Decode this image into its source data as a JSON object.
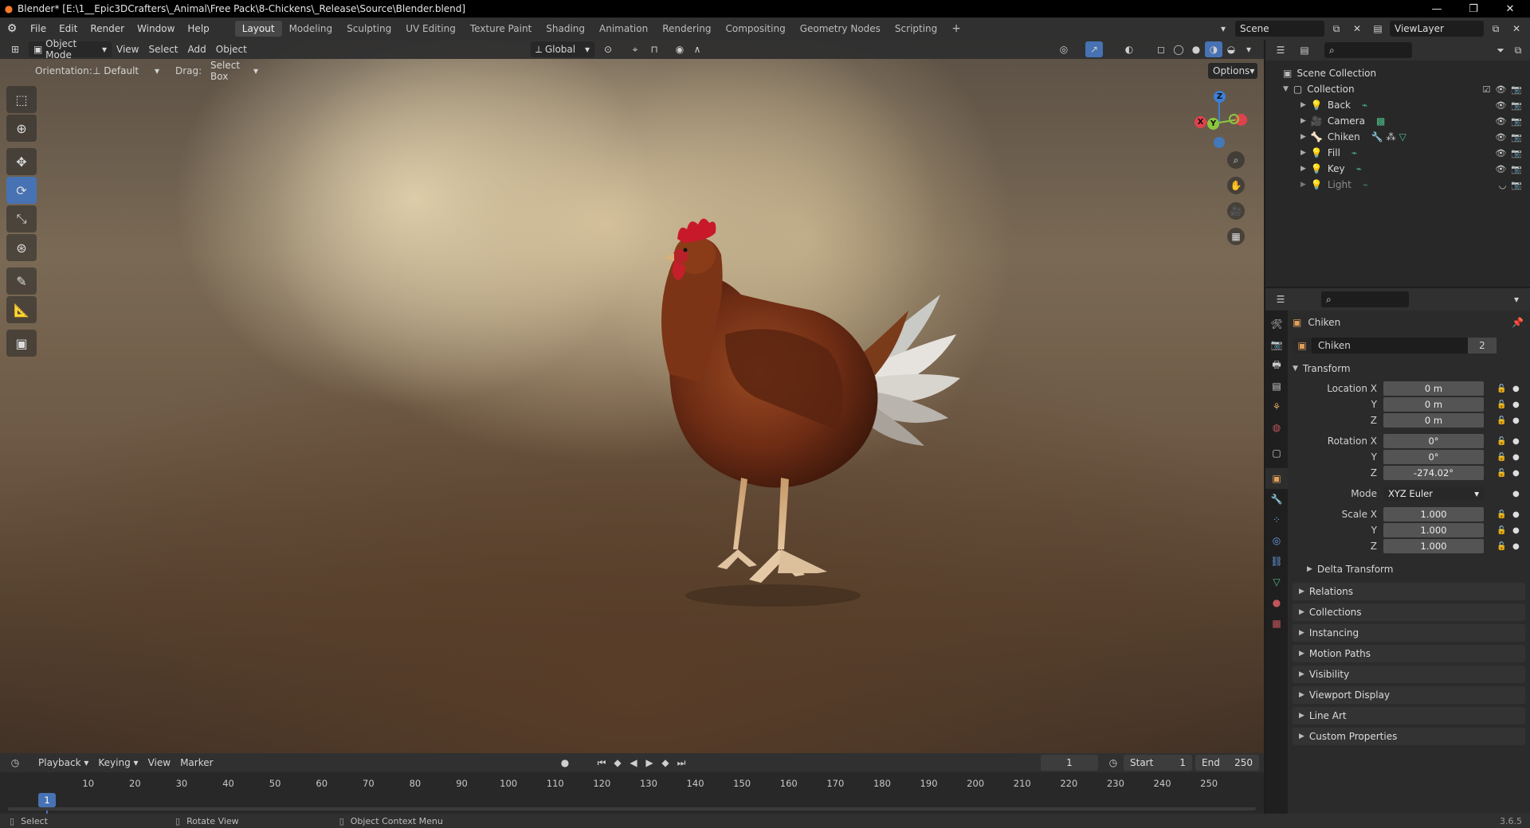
{
  "window": {
    "title": "Blender* [E:\\1__Epic3DCrafters\\_Animal\\Free Pack\\8-Chickens\\_Release\\Source\\Blender.blend]",
    "controls": [
      "—",
      "❐",
      "✕"
    ]
  },
  "menu": {
    "items": [
      "File",
      "Edit",
      "Render",
      "Window",
      "Help"
    ],
    "workspaces": [
      "Layout",
      "Modeling",
      "Sculpting",
      "UV Editing",
      "Texture Paint",
      "Shading",
      "Animation",
      "Rendering",
      "Compositing",
      "Geometry Nodes",
      "Scripting"
    ],
    "active_workspace": "Layout",
    "add_tab": "+",
    "scene": "Scene",
    "view_layer": "ViewLayer"
  },
  "viewport": {
    "mode": "Object Mode",
    "menus": [
      "View",
      "Select",
      "Add",
      "Object"
    ],
    "transform_orientation": "Global",
    "orientation_label": "Orientation:",
    "orientation_value": "Default",
    "drag_label": "Drag:",
    "drag_value": "Select Box",
    "options": "Options",
    "gizmo": {
      "z": "Z",
      "y": "Y",
      "x": "X"
    },
    "colors": {
      "accent": "#4772b3",
      "x_axis": "#e0424d",
      "y_axis": "#8cc63e",
      "z_axis": "#3b7fd6"
    }
  },
  "toolbar": {
    "tools": [
      "select-box",
      "cursor",
      "move",
      "rotate",
      "scale",
      "transform",
      "annotate",
      "measure",
      "add-cube"
    ],
    "active_tool": "rotate"
  },
  "outliner": {
    "root": "Scene Collection",
    "collection": "Collection",
    "items": [
      {
        "name": "Back",
        "type": "light"
      },
      {
        "name": "Camera",
        "type": "camera"
      },
      {
        "name": "Chiken",
        "type": "armature"
      },
      {
        "name": "Fill",
        "type": "light"
      },
      {
        "name": "Key",
        "type": "light"
      },
      {
        "name": "Light",
        "type": "light"
      }
    ]
  },
  "properties": {
    "object_name": "Chiken",
    "datablock_name": "Chiken",
    "user_count": "2",
    "transform_header": "Transform",
    "location": {
      "label": "Location X",
      "x": "0 m",
      "y": "0 m",
      "z": "0 m"
    },
    "rotation": {
      "label": "Rotation X",
      "x": "0°",
      "y": "0°",
      "z": "-274.02°"
    },
    "axis_labels": {
      "y": "Y",
      "z": "Z"
    },
    "mode_label": "Mode",
    "mode_value": "XYZ Euler",
    "scale": {
      "label": "Scale X",
      "x": "1.000",
      "y": "1.000",
      "z": "1.000"
    },
    "delta_transform": "Delta Transform",
    "panels": [
      "Relations",
      "Collections",
      "Instancing",
      "Motion Paths",
      "Visibility",
      "Viewport Display",
      "Line Art",
      "Custom Properties"
    ]
  },
  "timeline": {
    "menus": [
      "Playback",
      "Keying",
      "View",
      "Marker"
    ],
    "current_frame": "1",
    "start_label": "Start",
    "start": "1",
    "end_label": "End",
    "end": "250",
    "frames": [
      "10",
      "20",
      "30",
      "40",
      "50",
      "60",
      "70",
      "80",
      "90",
      "100",
      "110",
      "120",
      "130",
      "140",
      "150",
      "160",
      "170",
      "180",
      "190",
      "200",
      "210",
      "220",
      "230",
      "240",
      "250"
    ]
  },
  "status": {
    "select": "Select",
    "rotate_view": "Rotate View",
    "context_menu": "Object Context Menu",
    "version": "3.6.5"
  }
}
